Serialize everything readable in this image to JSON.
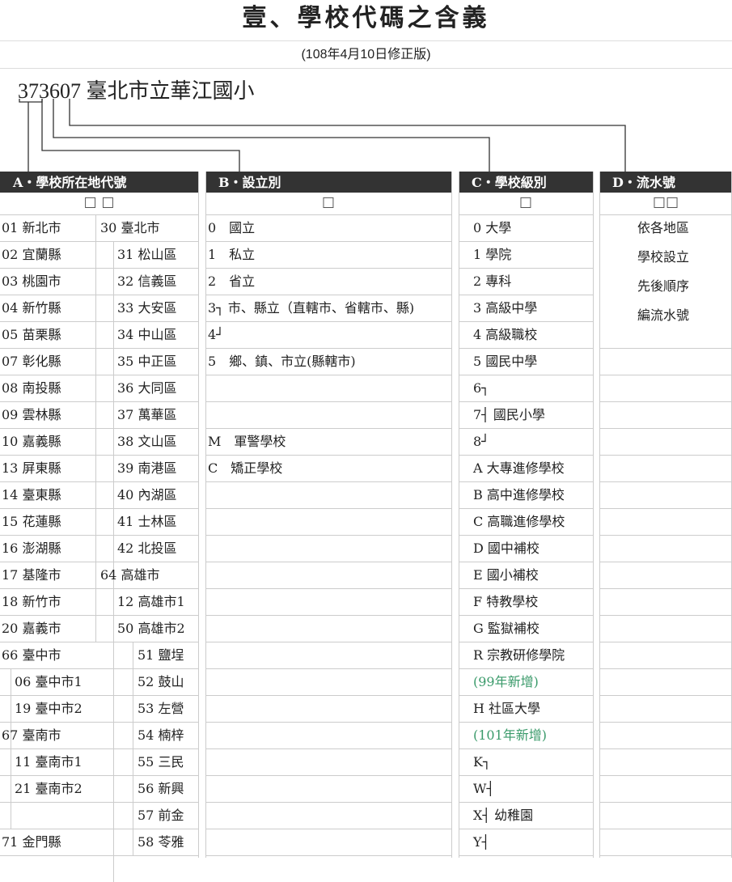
{
  "title": "壹、學校代碼之含義",
  "subtitle": "(108年4月10日修正版)",
  "example": {
    "code": "373607",
    "name": "臺北市立華江國小"
  },
  "headers": {
    "a": "A・學校所在地代號",
    "b": "B・設立別",
    "c": "C・學校級別",
    "d": "D・流水號"
  },
  "boxes": {
    "a": "☐ ☐",
    "b": "☐",
    "c": "☐",
    "d": "☐☐"
  },
  "a_rows": [
    {
      "c1": "01  新北市",
      "c2": "30  臺北市",
      "c3": ""
    },
    {
      "c1": "02  宜蘭縣",
      "c2": "31  松山區",
      "c3": ""
    },
    {
      "c1": "03  桃園市",
      "c2": "32  信義區",
      "c3": ""
    },
    {
      "c1": "04  新竹縣",
      "c2": "33  大安區",
      "c3": ""
    },
    {
      "c1": "05  苗栗縣",
      "c2": "34  中山區",
      "c3": ""
    },
    {
      "c1": "07  彰化縣",
      "c2": "35  中正區",
      "c3": ""
    },
    {
      "c1": "08  南投縣",
      "c2": "36  大同區",
      "c3": ""
    },
    {
      "c1": "09  雲林縣",
      "c2": "37  萬華區",
      "c3": ""
    },
    {
      "c1": "10  嘉義縣",
      "c2": "38  文山區",
      "c3": ""
    },
    {
      "c1": "13  屏東縣",
      "c2": "39  南港區",
      "c3": ""
    },
    {
      "c1": "14  臺東縣",
      "c2": "40  內湖區",
      "c3": ""
    },
    {
      "c1": "15  花蓮縣",
      "c2": "41  士林區",
      "c3": ""
    },
    {
      "c1": "16  澎湖縣",
      "c2": "42  北投區",
      "c3": ""
    },
    {
      "c1": "17  基隆市",
      "c2": "64  高雄市",
      "c3": ""
    },
    {
      "c1": "18  新竹市",
      "c2": "12  高雄市1",
      "c3": ""
    },
    {
      "c1": "20  嘉義市",
      "c2": "50  高雄市2",
      "c3": ""
    },
    {
      "c1": "66  臺中市",
      "c2": "",
      "c3": "51  鹽埕"
    },
    {
      "c1": "06  臺中市1",
      "c2": "",
      "c3": "52  鼓山"
    },
    {
      "c1": "19  臺中市2",
      "c2": "",
      "c3": "53  左營"
    },
    {
      "c1": "67  臺南市",
      "c2": "",
      "c3": "54  楠梓"
    },
    {
      "c1": "11  臺南市1",
      "c2": "",
      "c3": "55  三民"
    },
    {
      "c1": "21  臺南市2",
      "c2": "",
      "c3": "56  新興"
    },
    {
      "c1": "",
      "c2": "",
      "c3": "57  前金"
    },
    {
      "c1": "71  金門縣",
      "c2": "",
      "c3": "58  苓雅"
    }
  ],
  "b_rows": [
    "0　國立",
    "1　私立",
    "2　省立",
    "3┐ 市、縣立（直轄市、省轄市、縣)",
    "4┘",
    "5　鄉、鎮、市立(縣轄市)",
    "",
    "",
    "M　軍警學校",
    "C　矯正學校"
  ],
  "c_rows": [
    "0  大學",
    "1  學院",
    "2  專科",
    "3  高級中學",
    "4  高級職校",
    "5  國民中學",
    "6┐",
    "7┤ 國民小學",
    "8┘",
    "A  大專進修學校",
    "B  高中進修學校",
    "C  高職進修學校",
    "D  國中補校",
    "E  國小補校",
    "F  特教學校",
    "G  監獄補校",
    "R  宗教研修學院",
    "(99年新增)",
    "H  社區大學",
    "(101年新增)",
    "K┐",
    "W┤",
    "X┤ 幼稚園",
    "Y┤"
  ],
  "c_green_rows": [
    17,
    19
  ],
  "d_text": [
    "依各地區",
    "學校設立",
    "先後順序",
    "編流水號"
  ]
}
